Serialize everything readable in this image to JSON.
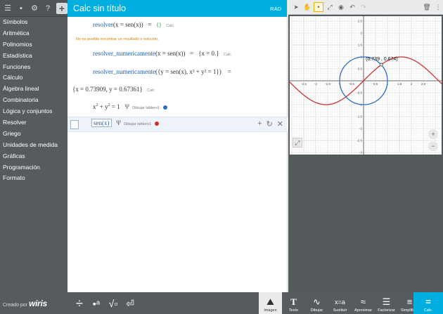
{
  "sidebar": {
    "items": [
      "Símbolos",
      "Aritmética",
      "Polinomios",
      "Estadística",
      "Funciones",
      "Cálculo",
      "Álgebra lineal",
      "Combinatoria",
      "Lógica y conjuntos",
      "Resolver",
      "Griego",
      "Unidades de medida",
      "Gráficas",
      "Programación",
      "Formato"
    ],
    "brand_prefix": "Creado por",
    "brand_name": "wiris"
  },
  "document": {
    "title": "Calc sin título",
    "angle_mode": "RAD",
    "line1": {
      "fn": "resolver",
      "arg": "(x = sen(x))",
      "eq": "=",
      "result": "{}",
      "calc": "Calc"
    },
    "warning": "No es posible encontrar un resultado o solución.",
    "line2": {
      "fn": "resolver_numericamente",
      "arg": "(x = sen(x))",
      "eq": "=",
      "result": "{x = 0.}",
      "calc": "Calc"
    },
    "line3": {
      "fn": "resolver_numericamente",
      "arg": "({y = sen(x), x² + y² = 1})",
      "eq": "="
    },
    "line3_result": {
      "result": "{x = 0.73909, y = 0.67361}",
      "calc": "Calc"
    },
    "line4": {
      "expr_a": "x",
      "expr_b": "+ y",
      "expr_c": "= 1",
      "sup": "2",
      "draw": "Dibujar tablero1",
      "color": "#2e6bc4"
    },
    "line5": {
      "expr": "sen(x)",
      "draw": "Dibujar tablero1",
      "color": "#cc3333"
    }
  },
  "graph": {
    "point_label": "(0.739 , 0.674)",
    "x_ticks": [
      "-2.5",
      "-2",
      "-1.5",
      "-1",
      "-0.5",
      "0.5",
      "1",
      "1.5",
      "2",
      "2.5"
    ],
    "y_ticks": [
      "2.5",
      "2",
      "1.5",
      "1",
      "0.5",
      "-0.5",
      "-1",
      "-1.5",
      "-2",
      "-2.5",
      "-3"
    ],
    "series": [
      {
        "name": "sen(x)",
        "color": "#cc3333"
      },
      {
        "name": "x²+y²=1",
        "color": "#2e6bc4"
      }
    ]
  },
  "bottombar": {
    "buttons": [
      "Imagen",
      "Texto",
      "Dibujar",
      "Sustituir",
      "Aproximar",
      "Factorizar",
      "Simplificar",
      "Calc."
    ]
  }
}
